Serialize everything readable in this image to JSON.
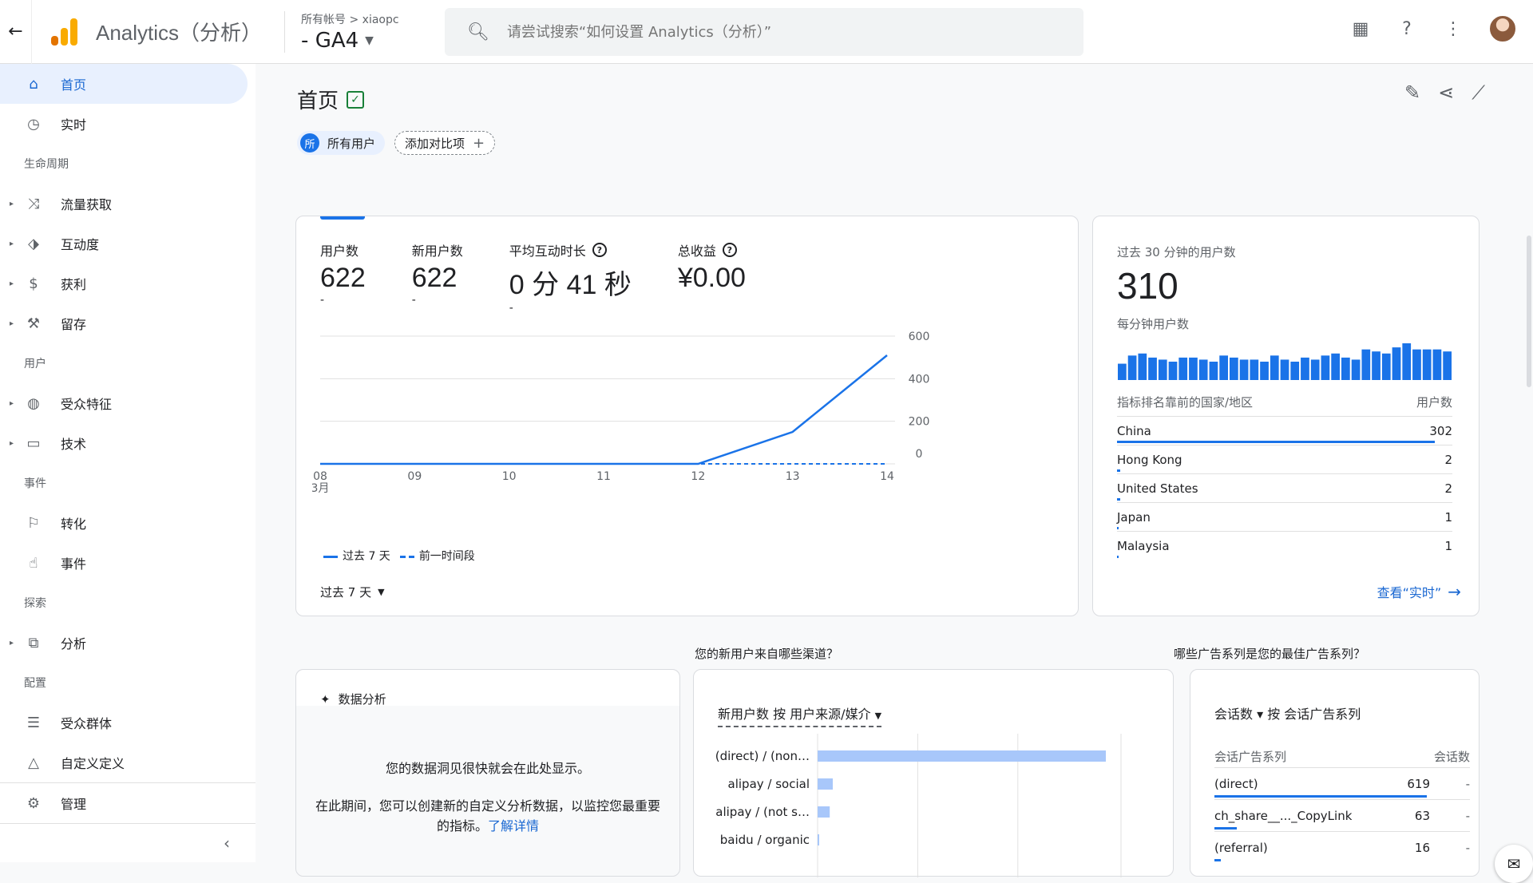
{
  "header": {
    "app_title": "Analytics（分析）",
    "breadcrumb": "所有帐号 > xiaopc",
    "property": "- GA4",
    "search_placeholder": "请尝试搜索“如何设置 Analytics（分析）”"
  },
  "sidebar": {
    "items": [
      {
        "label": "首页",
        "icon": "home-icon",
        "active": true
      },
      {
        "label": "实时",
        "icon": "clock-icon"
      }
    ],
    "sections": [
      {
        "title": "生命周期",
        "items": [
          {
            "label": "流量获取",
            "icon": "acquisition-icon"
          },
          {
            "label": "互动度",
            "icon": "engagement-icon"
          },
          {
            "label": "获利",
            "icon": "monetization-icon"
          },
          {
            "label": "留存",
            "icon": "retention-icon"
          }
        ]
      },
      {
        "title": "用户",
        "items": [
          {
            "label": "受众特征",
            "icon": "globe-icon"
          },
          {
            "label": "技术",
            "icon": "devices-icon"
          }
        ]
      },
      {
        "title": "事件",
        "items": [
          {
            "label": "转化",
            "icon": "flag-icon"
          },
          {
            "label": "事件",
            "icon": "touch-icon"
          }
        ]
      },
      {
        "title": "探索",
        "items": [
          {
            "label": "分析",
            "icon": "explore-icon"
          }
        ]
      },
      {
        "title": "配置",
        "items": [
          {
            "label": "受众群体",
            "icon": "audience-icon"
          },
          {
            "label": "自定义定义",
            "icon": "shapes-icon"
          }
        ]
      }
    ],
    "admin_label": "管理"
  },
  "page": {
    "title": "首页",
    "chip_all_users": "所有用户",
    "chip_badge": "所",
    "chip_add": "添加对比项"
  },
  "metrics": [
    {
      "label": "用户数",
      "value": "622",
      "delta": "-"
    },
    {
      "label": "新用户数",
      "value": "622",
      "delta": "-"
    },
    {
      "label": "平均互动时长",
      "value": "0 分 41 秒",
      "delta": "-",
      "help": true
    },
    {
      "label": "总收益",
      "value": "¥0.00",
      "delta": "",
      "help": true
    }
  ],
  "chart_data": {
    "type": "line",
    "x": [
      "08 3月",
      "09",
      "10",
      "11",
      "12",
      "13",
      "14"
    ],
    "series": [
      {
        "name": "过去 7 天",
        "values": [
          0,
          0,
          0,
          0,
          0,
          150,
          510
        ]
      },
      {
        "name": "前一时间段",
        "values": [
          0,
          0,
          0,
          0,
          0,
          0,
          0
        ]
      }
    ],
    "y_ticks": [
      "0",
      "200",
      "400",
      "600"
    ],
    "ylim": [
      0,
      600
    ],
    "colors": {
      "primary": "#1a73e8"
    }
  },
  "chart_labels": {
    "legend_current": "过去 7 天",
    "legend_previous": "前一时间段",
    "range": "过去 7 天"
  },
  "realtime": {
    "title": "过去 30 分钟的用户数",
    "value": "310",
    "per_minute_label": "每分钟用户数",
    "per_minute_values": [
      8,
      12,
      13,
      11,
      10,
      9,
      11,
      11,
      10,
      9,
      12,
      11,
      10,
      10,
      9,
      12,
      10,
      9,
      11,
      10,
      12,
      13,
      11,
      10,
      15,
      14,
      13,
      16,
      18,
      15,
      15,
      15,
      14
    ],
    "table_header_left": "指标排名靠前的国家/地区",
    "table_header_right": "用户数",
    "rows": [
      {
        "country": "China",
        "users": "302",
        "share": 0.97
      },
      {
        "country": "Hong Kong",
        "users": "2",
        "share": 0.01
      },
      {
        "country": "United States",
        "users": "2",
        "share": 0.01
      },
      {
        "country": "Japan",
        "users": "1",
        "share": 0.005
      },
      {
        "country": "Malaysia",
        "users": "1",
        "share": 0.005
      }
    ],
    "link": "查看“实时”"
  },
  "questions": {
    "channels": "您的新用户来自哪些渠道？",
    "campaigns": "哪些广告系列是您的最佳广告系列？"
  },
  "insights": {
    "title": "数据分析",
    "msg": "您的数据洞见很快就会在此处显示。",
    "msg2": "在此期间，您可以创建新的自定义分析数据，以监控您最重要的指标。",
    "link": "了解详情"
  },
  "channels_card": {
    "header": "新用户数 按 用户来源/媒介",
    "rows": [
      {
        "label": "(direct) / (non…",
        "value": 0.95
      },
      {
        "label": "alipay / social",
        "value": 0.05
      },
      {
        "label": "alipay / (not s…",
        "value": 0.04
      },
      {
        "label": "baidu / organic",
        "value": 0.005
      }
    ]
  },
  "campaign_card": {
    "header": "会话数 ▾ 按 会话广告系列",
    "col1": "会话广告系列",
    "col2": "会话数",
    "rows": [
      {
        "name": "(direct)",
        "value": "619",
        "delta": "-",
        "share": 0.95
      },
      {
        "name": "ch_share__..._CopyLink",
        "value": "63",
        "delta": "-",
        "share": 0.1
      },
      {
        "name": "(referral)",
        "value": "16",
        "delta": "-",
        "share": 0.03
      }
    ]
  }
}
